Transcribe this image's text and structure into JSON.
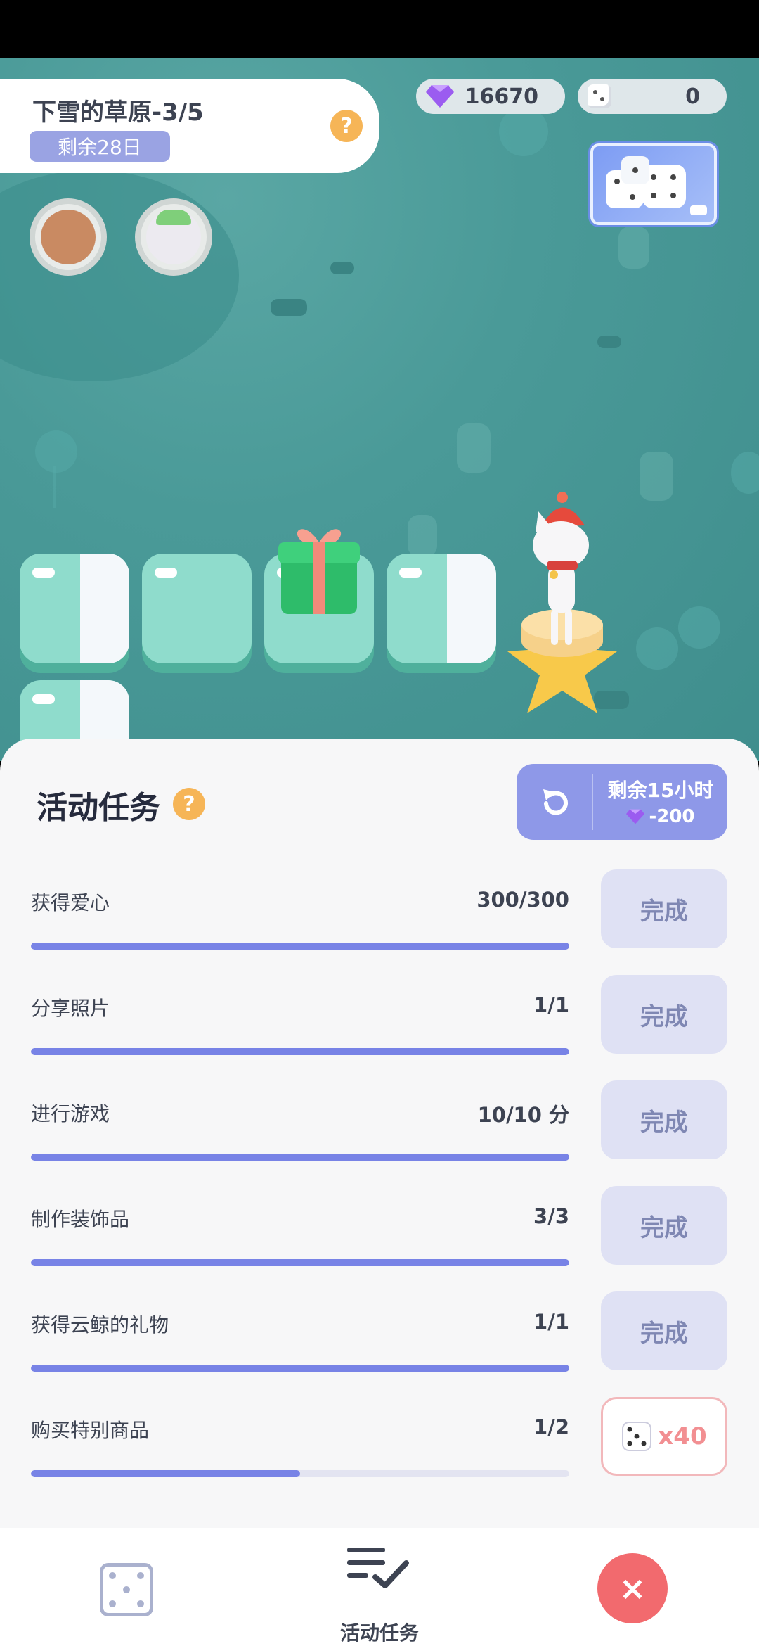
{
  "event": {
    "title": "下雪的草原-3/5",
    "days_remaining": "剩余28日",
    "help_icon": "?"
  },
  "currency": {
    "gems": "16670",
    "dice": "0"
  },
  "tasks_panel": {
    "title": "活动任务",
    "help_icon": "?",
    "refresh": {
      "time_left": "剩余15小时",
      "cost": "-200"
    },
    "tasks": [
      {
        "label": "获得爱心",
        "progress": "300/300",
        "fill": 1.0,
        "action": "完成"
      },
      {
        "label": "分享照片",
        "progress": "1/1",
        "fill": 1.0,
        "action": "完成"
      },
      {
        "label": "进行游戏",
        "progress": "10/10 分",
        "fill": 1.0,
        "action": "完成"
      },
      {
        "label": "制作装饰品",
        "progress": "3/3",
        "fill": 1.0,
        "action": "完成"
      },
      {
        "label": "获得云鲸的礼物",
        "progress": "1/1",
        "fill": 1.0,
        "action": "完成"
      },
      {
        "label": "购买特别商品",
        "progress": "1/2",
        "fill": 0.5,
        "action": "x40"
      }
    ]
  },
  "bottom_nav": {
    "tasks_label": "活动任务",
    "close_icon": "×"
  },
  "colors": {
    "accent": "#7883e6",
    "game_bg": "#4a9a98",
    "close": "#f26a6e",
    "help": "#f6b557"
  }
}
